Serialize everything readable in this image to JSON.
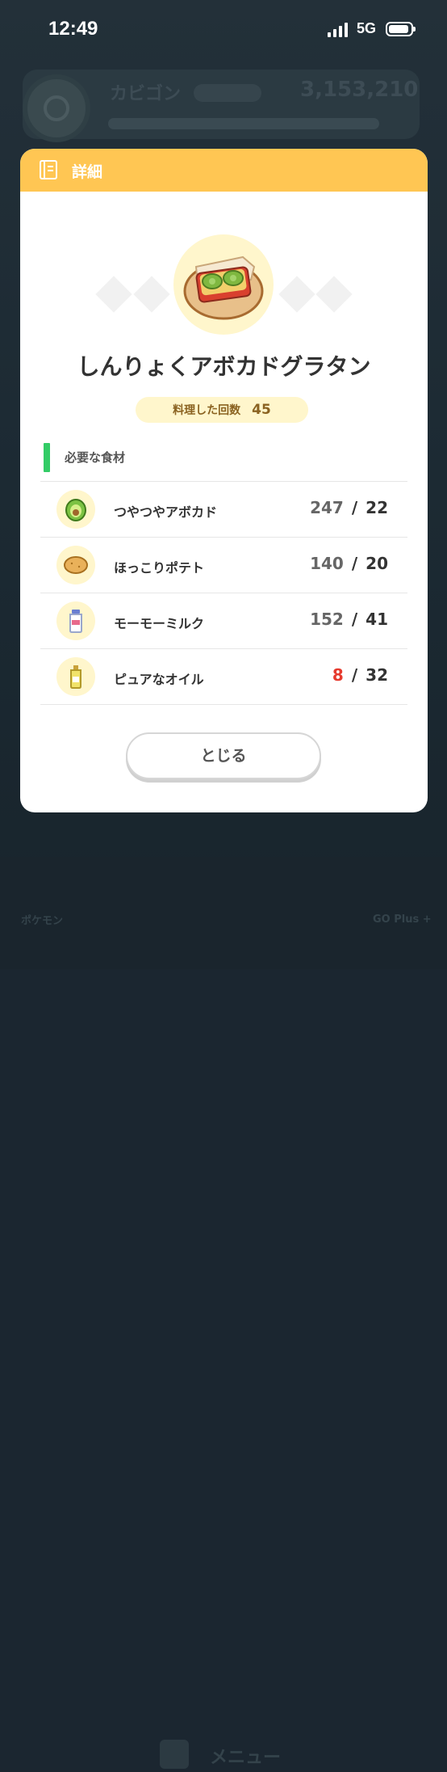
{
  "status_bar": {
    "time": "12:49",
    "network": "5G"
  },
  "background": {
    "pokemon_name": "カビゴン",
    "power": "3,153,210",
    "menu_label": "メニュー",
    "nav_left": "ポケモン",
    "nav_right": "GO Plus +"
  },
  "modal": {
    "title": "詳細",
    "dish_name": "しんりょくアボカドグラタン",
    "cooked_count_label": "料理した回数",
    "cooked_count": "45",
    "section_title": "必要な食材",
    "ingredients": [
      {
        "name": "つやつやアボカド",
        "have": "247",
        "need": "22",
        "icon": "avocado-icon",
        "short": false
      },
      {
        "name": "ほっこりポテト",
        "have": "140",
        "need": "20",
        "icon": "potato-icon",
        "short": false
      },
      {
        "name": "モーモーミルク",
        "have": "152",
        "need": "41",
        "icon": "milk-icon",
        "short": false
      },
      {
        "name": "ピュアなオイル",
        "have": "8",
        "need": "32",
        "icon": "oil-icon",
        "short": true
      }
    ],
    "separator": "/",
    "close_label": "とじる"
  },
  "colors": {
    "header": "#ffc653",
    "accent_green": "#33cc66",
    "shortage_red": "#e63a2e",
    "pill_bg": "#fff6cc"
  }
}
